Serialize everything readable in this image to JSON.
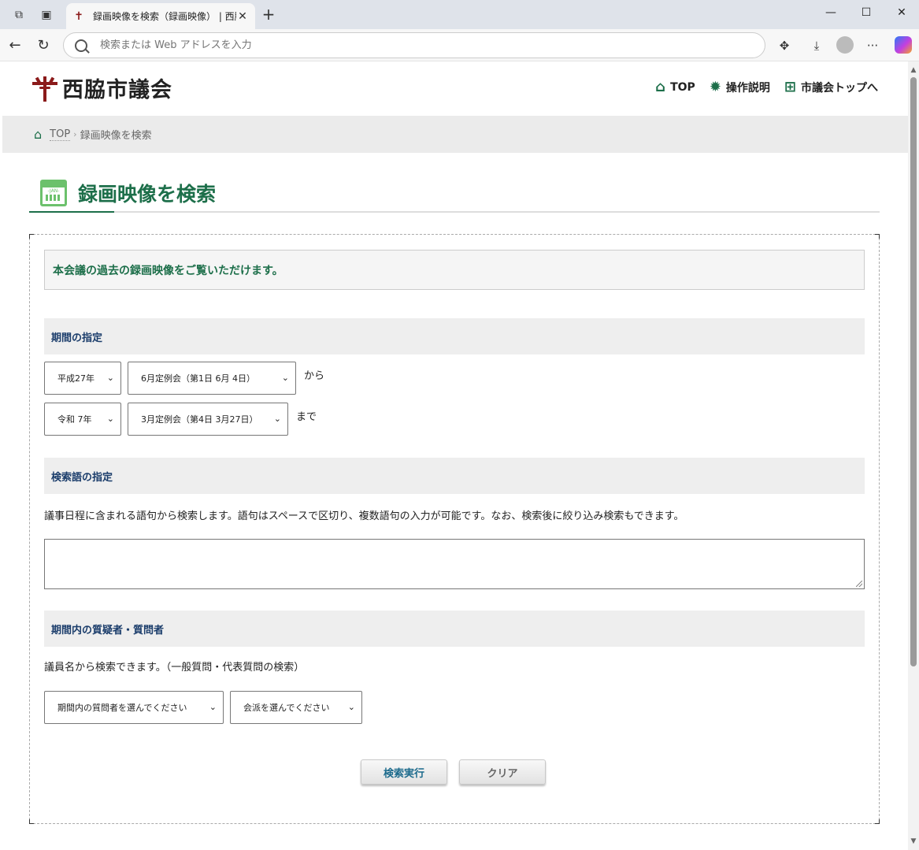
{
  "browser": {
    "tab_title": "録画映像を検索（録画映像） | 西脇",
    "tab_close": "✕",
    "new_tab": "+",
    "address_placeholder": "検索または Web アドレスを入力"
  },
  "header": {
    "site_name": "西脇市議会",
    "nav": [
      {
        "label": "TOP",
        "icon": "home-icon"
      },
      {
        "label": "操作説明",
        "icon": "gear-icon"
      },
      {
        "label": "市議会トップへ",
        "icon": "sitemap-icon"
      }
    ]
  },
  "breadcrumb": {
    "home": "TOP",
    "separator": "›",
    "current": "録画映像を検索"
  },
  "page": {
    "title": "録画映像を検索",
    "calendar_label": "-JAN-",
    "intro": "本会議の過去の録画映像をご覧いただけます。"
  },
  "period": {
    "heading": "期間の指定",
    "from_era": "平成27年",
    "from_session": "6月定例会（第1日 6月 4日）",
    "from_suffix": "から",
    "to_era": "令和 7年",
    "to_session": "3月定例会（第4日 3月27日）",
    "to_suffix": "まで"
  },
  "keyword": {
    "heading": "検索語の指定",
    "description": "議事日程に含まれる語句から検索します。語句はスペースで区切り、複数語句の入力が可能です。なお、検索後に絞り込み検索もできます。",
    "value": ""
  },
  "questioner": {
    "heading": "期間内の質疑者・質問者",
    "description": "議員名から検索できます。（一般質問・代表質問の検索）",
    "member_select": "期間内の質問者を選んでください",
    "faction_select": "会派を選んでください"
  },
  "buttons": {
    "search": "検索実行",
    "clear": "クリア"
  },
  "colors": {
    "accent_green": "#1d6f4a",
    "heading_blue": "#1b3d6b",
    "logo_red": "#8b1a1a"
  }
}
